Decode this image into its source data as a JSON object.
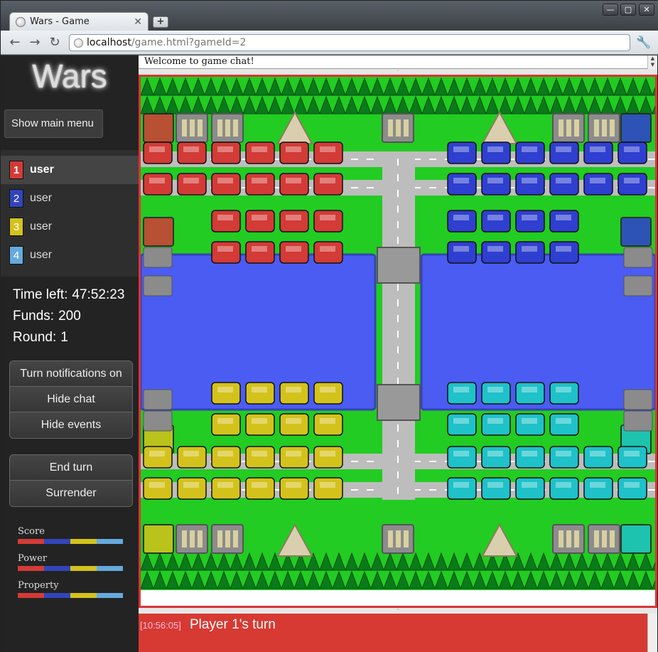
{
  "browser": {
    "tab_title": "Wars - Game",
    "url_host": "localhost",
    "url_path": "/game.html?gameId=2"
  },
  "sidebar": {
    "logo": "Wars",
    "main_menu_label": "Show main menu",
    "players": [
      {
        "number": "1",
        "name": "user",
        "color": "#d33b36",
        "active": true
      },
      {
        "number": "2",
        "name": "user",
        "color": "#3344bb",
        "active": false
      },
      {
        "number": "3",
        "name": "user",
        "color": "#d4c21c",
        "active": false
      },
      {
        "number": "4",
        "name": "user",
        "color": "#66aadd",
        "active": false
      }
    ],
    "stats": {
      "time_left_label": "Time left:",
      "time_left": "47:52:23",
      "funds_label": "Funds:",
      "funds": "200",
      "round_label": "Round:",
      "round": "1"
    },
    "options": {
      "notifications_label": "Turn notifications on",
      "hide_chat_label": "Hide chat",
      "hide_events_label": "Hide events"
    },
    "actions": {
      "end_turn_label": "End turn",
      "surrender_label": "Surrender"
    },
    "graphs": {
      "score_label": "Score",
      "power_label": "Power",
      "property_label": "Property",
      "shares": [
        0.25,
        0.25,
        0.25,
        0.25
      ]
    }
  },
  "chat": {
    "welcome": "Welcome to game chat!"
  },
  "events": {
    "time": "[10:56:05]",
    "message": "Player 1's turn"
  },
  "colors": {
    "red": "#d33b36",
    "blue": "#2f3fd0",
    "yellow": "#d4c21c",
    "cyan": "#1ec2c8",
    "grass": "#22cc22",
    "water": "#4a5cf2",
    "road": "#bdbdbd"
  }
}
